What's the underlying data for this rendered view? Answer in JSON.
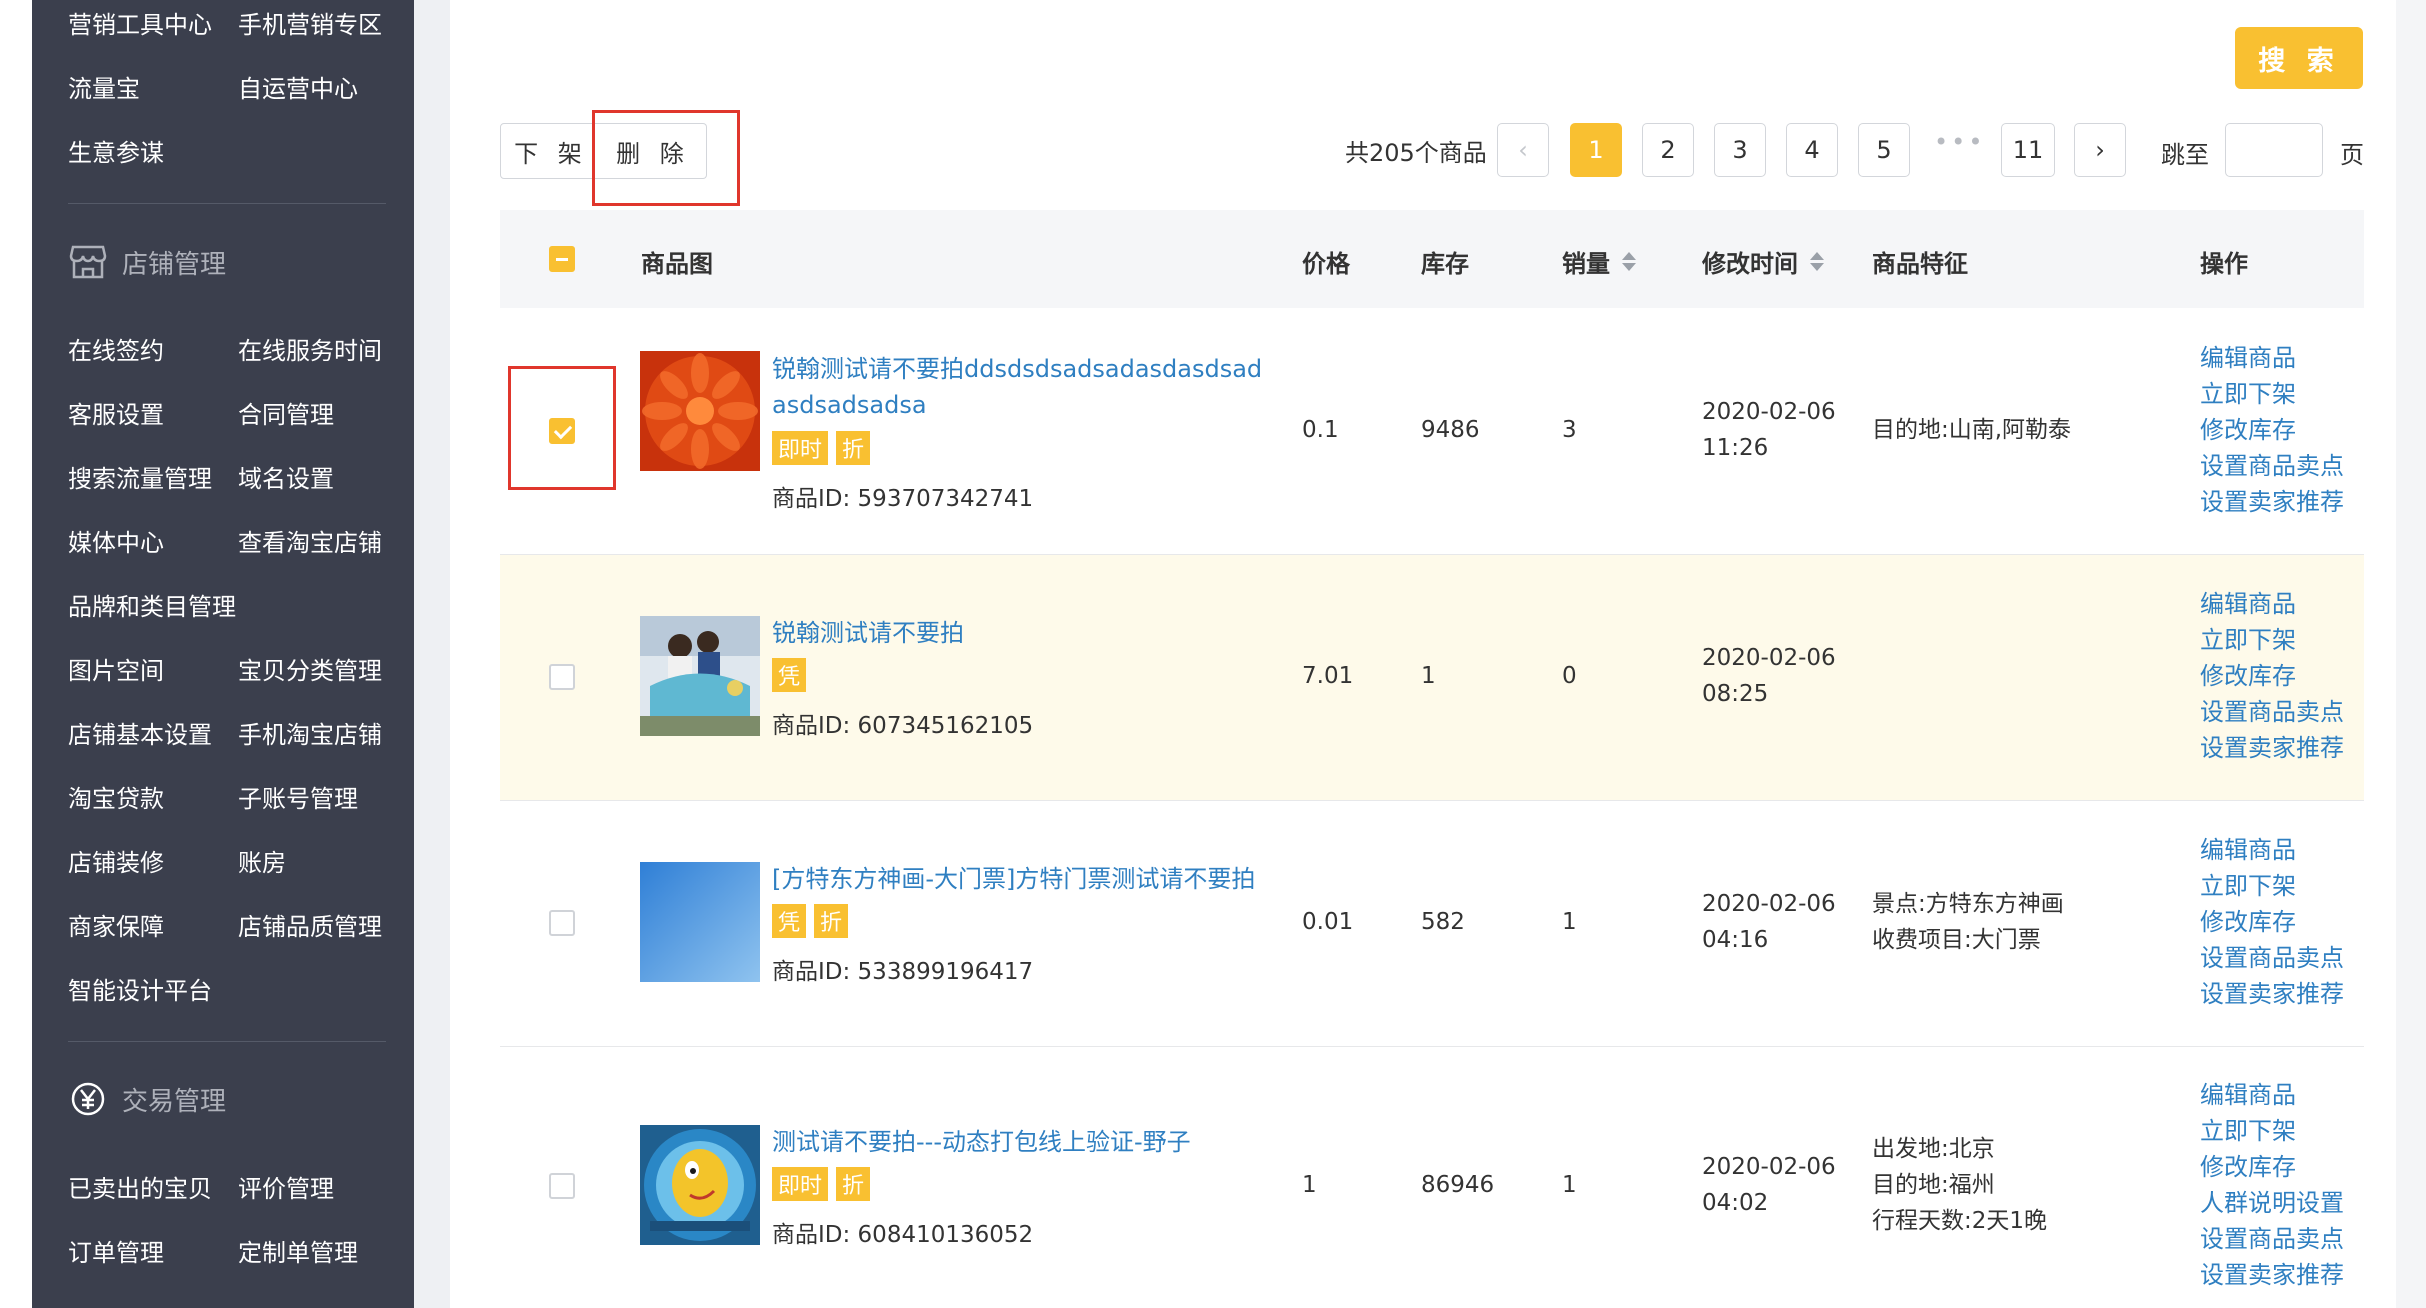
{
  "sidebar": {
    "top_items": [
      [
        "营销工具中心",
        "手机营销专区"
      ],
      [
        "流量宝",
        "自运营中心"
      ],
      [
        "生意参谋",
        ""
      ]
    ],
    "shop_section": {
      "title": "店铺管理",
      "icon": "store-icon",
      "items": [
        [
          "在线签约",
          "在线服务时间"
        ],
        [
          "客服设置",
          "合同管理"
        ],
        [
          "搜索流量管理",
          "域名设置"
        ],
        [
          "媒体中心",
          "查看淘宝店铺"
        ],
        [
          "品牌和类目管理",
          ""
        ],
        [
          "图片空间",
          "宝贝分类管理"
        ],
        [
          "店铺基本设置",
          "手机淘宝店铺"
        ],
        [
          "淘宝贷款",
          "子账号管理"
        ],
        [
          "店铺装修",
          "账房"
        ],
        [
          "商家保障",
          "店铺品质管理"
        ],
        [
          "智能设计平台",
          ""
        ]
      ]
    },
    "trade_section": {
      "title": "交易管理",
      "icon": "yuan-icon",
      "items": [
        [
          "已卖出的宝贝",
          "评价管理"
        ],
        [
          "订单管理",
          "定制单管理"
        ]
      ]
    }
  },
  "toolbar": {
    "search_label": "搜 索",
    "unlist_label": "下 架",
    "delete_label": "删 除",
    "total_text": "共205个商品",
    "pages": [
      "1",
      "2",
      "3",
      "4",
      "5"
    ],
    "last_page": "11",
    "current_page": "1",
    "ellipsis": "•••",
    "jump_label": "跳至",
    "page_unit": "页"
  },
  "table": {
    "headers": {
      "image": "商品图",
      "price": "价格",
      "stock": "库存",
      "sales": "销量",
      "modified": "修改时间",
      "features": "商品特征",
      "actions": "操作"
    },
    "rows": [
      {
        "title": "锐翰测试请不要拍ddsdsdsadsadasdasdsadasdsadsadsa",
        "tags": [
          "即时",
          "折"
        ],
        "product_id": "商品ID: 593707342741",
        "price": "0.1",
        "stock": "9486",
        "sales": "3",
        "date": "2020-02-06",
        "time": "11:26",
        "features": [
          "目的地:山南,阿勒泰"
        ],
        "ops": [
          "编辑商品",
          "立即下架",
          "修改库存",
          "设置商品卖点",
          "设置卖家推荐"
        ],
        "checked": true
      },
      {
        "title": "锐翰测试请不要拍",
        "tags": [
          "凭"
        ],
        "product_id": "商品ID: 607345162105",
        "price": "7.01",
        "stock": "1",
        "sales": "0",
        "date": "2020-02-06",
        "time": "08:25",
        "features": [],
        "ops": [
          "编辑商品",
          "立即下架",
          "修改库存",
          "设置商品卖点",
          "设置卖家推荐"
        ],
        "checked": false
      },
      {
        "title": "[方特东方神画-大门票]方特门票测试请不要拍",
        "tags": [
          "凭",
          "折"
        ],
        "product_id": "商品ID: 533899196417",
        "price": "0.01",
        "stock": "582",
        "sales": "1",
        "date": "2020-02-06",
        "time": "04:16",
        "features": [
          "景点:方特东方神画",
          "收费项目:大门票"
        ],
        "ops": [
          "编辑商品",
          "立即下架",
          "修改库存",
          "设置商品卖点",
          "设置卖家推荐"
        ],
        "checked": false
      },
      {
        "title": "测试请不要拍---动态打包线上验证-野子",
        "tags": [
          "即时",
          "折"
        ],
        "product_id": "商品ID: 608410136052",
        "price": "1",
        "stock": "86946",
        "sales": "1",
        "date": "2020-02-06",
        "time": "04:02",
        "features": [
          "出发地:北京",
          "目的地:福州",
          "行程天数:2天1晚"
        ],
        "ops": [
          "编辑商品",
          "立即下架",
          "修改库存",
          "人群说明设置",
          "设置商品卖点",
          "设置卖家推荐"
        ],
        "checked": false
      }
    ]
  },
  "colors": {
    "accent": "#f9c031",
    "link": "#2f7fc1",
    "sidebar_bg": "#3b3f4d",
    "highlight_box": "#e0362c",
    "row_highlight": "#fefaea"
  }
}
